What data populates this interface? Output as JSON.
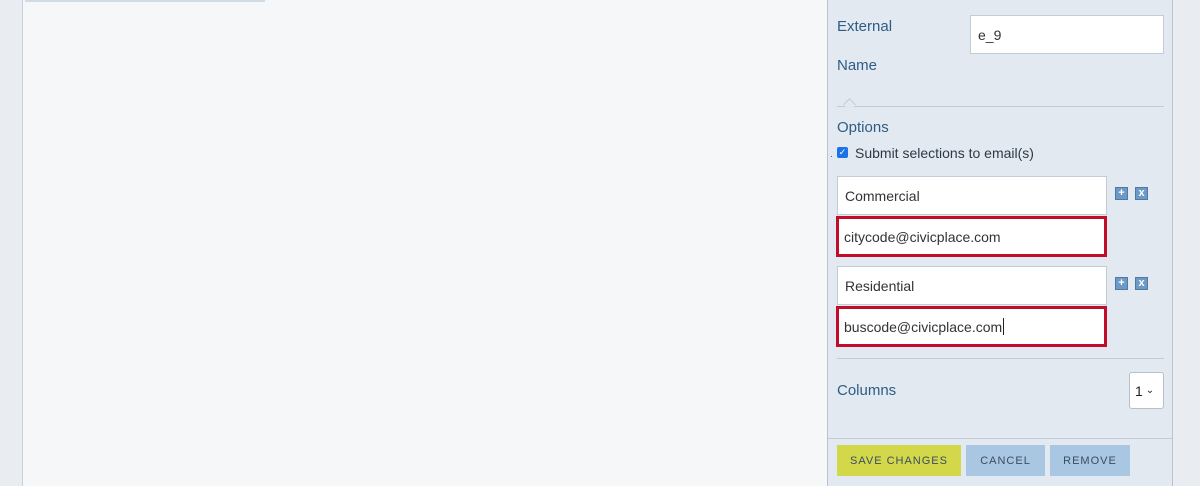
{
  "form": {
    "external_name_label_line1": "External",
    "external_name_label_line2": "Name",
    "external_name_value": "e_9",
    "options_label": "Options",
    "submit_checkbox_label": "Submit selections to email(s)",
    "submit_checkbox_checked": true,
    "options": [
      {
        "name": "Commercial",
        "email": "citycode@civicplace.com"
      },
      {
        "name": "Residential",
        "email": "buscode@civicplace.com"
      }
    ],
    "columns_label": "Columns",
    "columns_value": "1"
  },
  "actions": {
    "save_label": "SAVE CHANGES",
    "cancel_label": "CANCEL",
    "remove_label": "REMOVE"
  },
  "icons": {
    "add": "plus-icon",
    "remove": "x-icon"
  },
  "colors": {
    "highlight_border": "#c10d2a",
    "save_button": "#d3d84a",
    "secondary_button": "#a9c6e3",
    "label_text": "#2c5d86"
  }
}
